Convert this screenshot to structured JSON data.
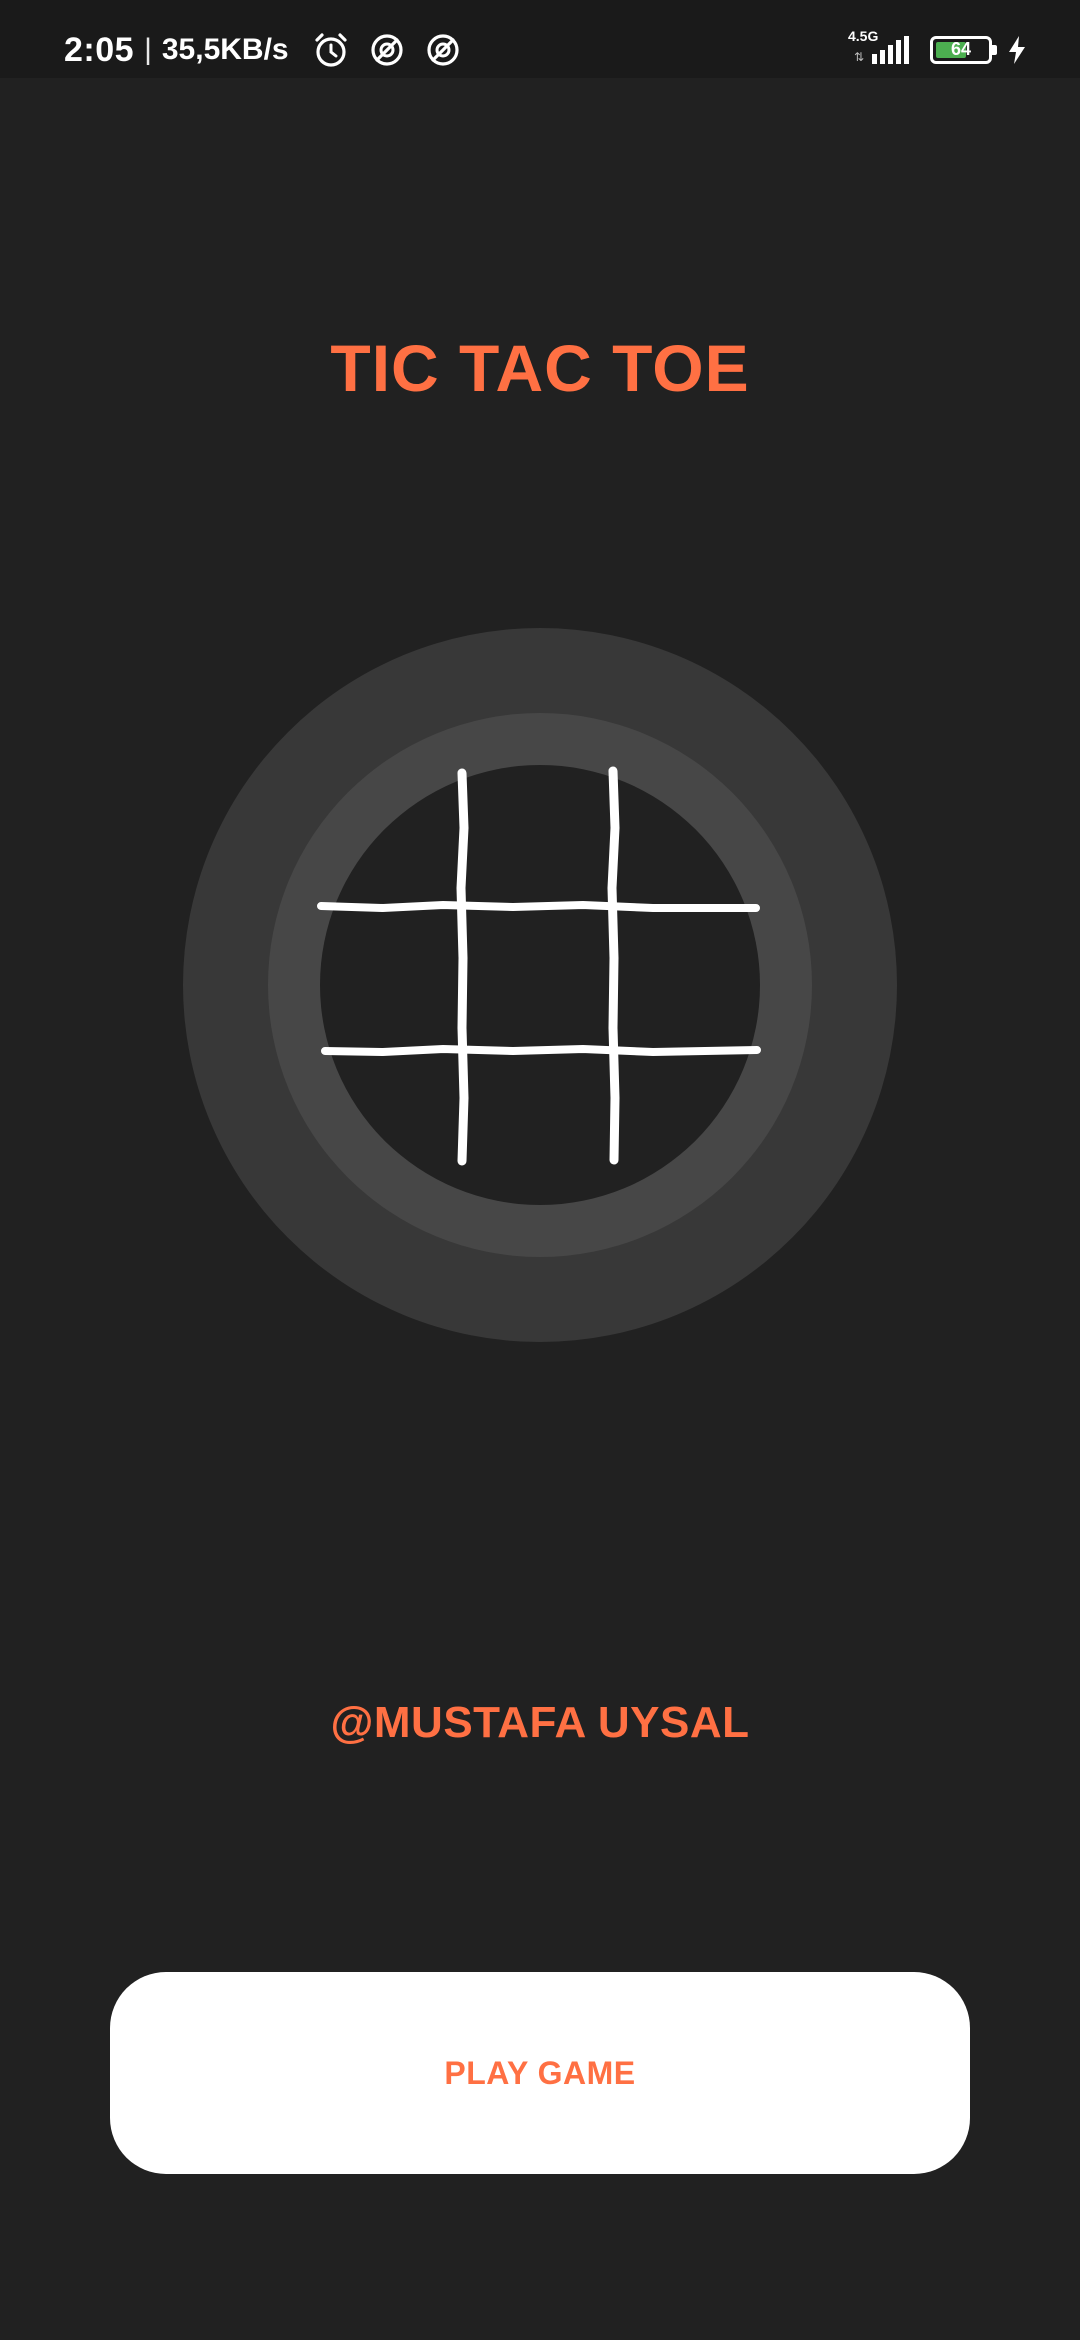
{
  "status_bar": {
    "time": "2:05",
    "separator": "|",
    "net_speed": "35,5KB/s",
    "network_type": "4.5G",
    "battery_level": "64",
    "battery_fraction": 0.64,
    "icons": [
      "alarm-icon",
      "notification-app-icon",
      "notification-app-icon",
      "signal-bars-icon",
      "battery-icon",
      "charging-bolt-icon"
    ]
  },
  "title": "TIC TAC TOE",
  "logo": {
    "icon": "tic-tac-toe-grid-icon"
  },
  "author": "@MUSTAFA UYSAL",
  "play_button": {
    "label": "PLAY GAME"
  },
  "colors": {
    "background": "#212121",
    "status_bar": "#1a1a1a",
    "accent": "#ff7043",
    "button_bg": "#ffffff",
    "ring_outer": "#383838",
    "ring_middle": "#474747",
    "logo_center": "#212121",
    "grid_lines": "#ffffff",
    "battery_fill": "#4caf50"
  }
}
